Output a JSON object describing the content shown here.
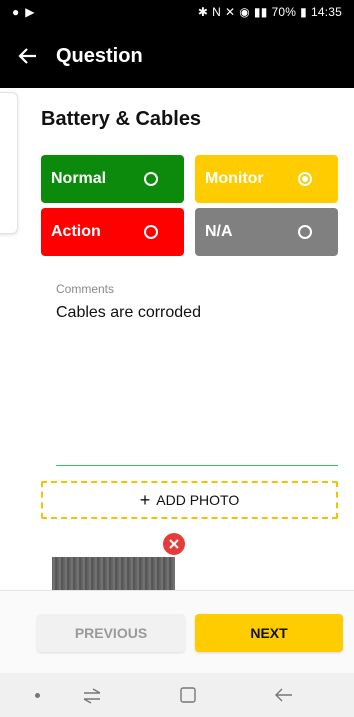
{
  "status_bar": {
    "left_icons": [
      "notification-icon",
      "play-icon"
    ],
    "battery": "70%",
    "time": "14:35"
  },
  "app_bar": {
    "title": "Question"
  },
  "question": {
    "title": "Battery & Cables",
    "options": [
      {
        "label": "Normal",
        "color": "#0b8a0b",
        "selected": false
      },
      {
        "label": "Monitor",
        "color": "#ffcc00",
        "selected": true
      },
      {
        "label": "Action",
        "color": "#ff0000",
        "selected": false
      },
      {
        "label": "N/A",
        "color": "#808080",
        "selected": false
      }
    ]
  },
  "comments": {
    "label": "Comments",
    "value": "Cables are corroded"
  },
  "add_photo": {
    "label": "ADD PHOTO"
  },
  "footer": {
    "previous_label": "PREVIOUS",
    "next_label": "NEXT"
  },
  "colors": {
    "accent": "#ffcc00",
    "divider_green": "#34c759",
    "remove_red": "#e63b3b"
  }
}
